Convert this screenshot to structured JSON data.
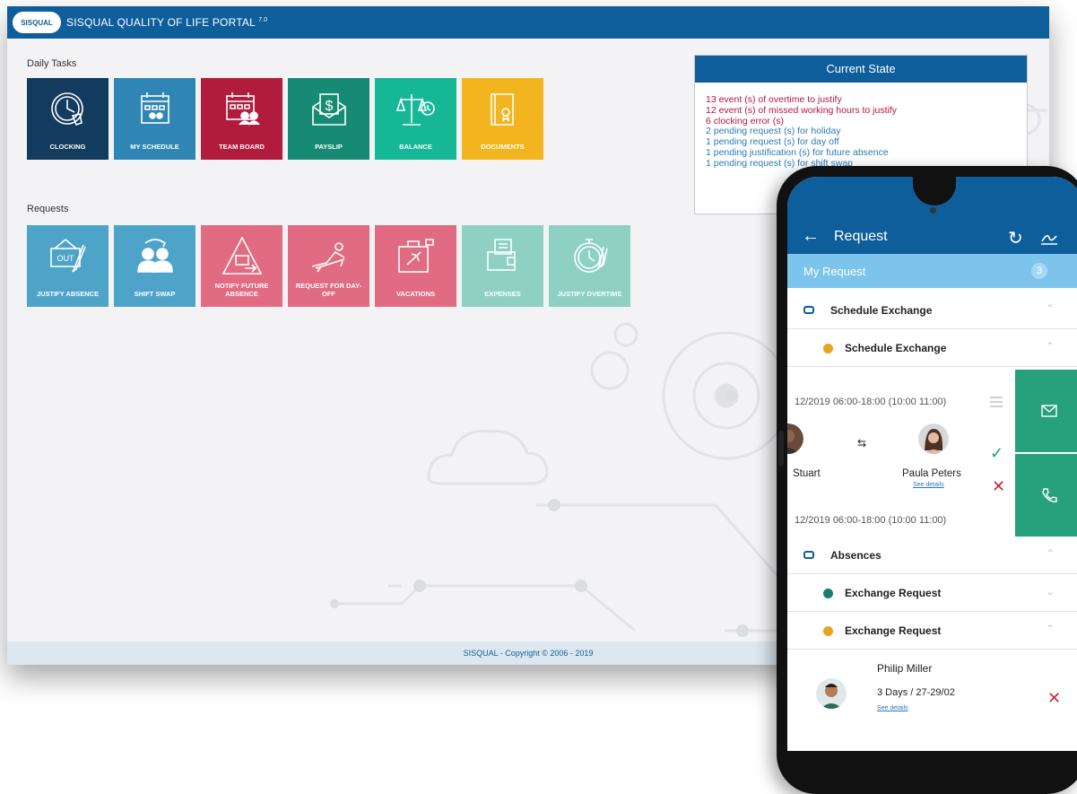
{
  "app": {
    "logo_text": "SISQUAL",
    "title": "SISQUAL QUALITY OF LIFE PORTAL",
    "version": "7.0"
  },
  "daily_tasks": {
    "title": "Daily Tasks",
    "tiles": [
      {
        "label": "CLOCKING",
        "icon": "clock-hand-icon",
        "color": "#123b5e"
      },
      {
        "label": "MY SCHEDULE",
        "icon": "calendar-user-icon",
        "color": "#2f86b4"
      },
      {
        "label": "TEAM BOARD",
        "icon": "calendar-team-icon",
        "color": "#b11c3c"
      },
      {
        "label": "PAYSLIP",
        "icon": "envelope-dollar-icon",
        "color": "#168a72"
      },
      {
        "label": "BALANCE",
        "icon": "scales-icon",
        "color": "#16b796"
      },
      {
        "label": "DOCUMENTS",
        "icon": "document-icon",
        "color": "#f3b51f"
      }
    ]
  },
  "requests": {
    "title": "Requests",
    "tiles": [
      {
        "label": "JUSTIFY ABSENCE",
        "icon": "out-sign-icon",
        "color": "#4ea3c8"
      },
      {
        "label": "SHIFT SWAP",
        "icon": "people-swap-icon",
        "color": "#4ea3c8"
      },
      {
        "label": "NOTIFY FUTURE ABSENCE",
        "icon": "warning-out-icon",
        "color": "#e06b82"
      },
      {
        "label": "REQUEST FOR DAY-OFF",
        "icon": "lounge-icon",
        "color": "#e06b82"
      },
      {
        "label": "VACATIONS",
        "icon": "suitcase-plane-icon",
        "color": "#e06b82"
      },
      {
        "label": "EXPENSES",
        "icon": "wallet-receipt-icon",
        "color": "#8ed1c2"
      },
      {
        "label": "JUSTIFY OVERTIME",
        "icon": "stopwatch-icon",
        "color": "#8ed1c2"
      }
    ]
  },
  "current_state": {
    "title": "Current State",
    "items": [
      {
        "text": "13 event (s) of overtime to justify",
        "tone": "red"
      },
      {
        "text": "12 event (s) of missed working hours to justify",
        "tone": "red"
      },
      {
        "text": "6 clocking error (s)",
        "tone": "red"
      },
      {
        "text": "2 pending request (s) for holiday",
        "tone": "blue"
      },
      {
        "text": "1 pending request (s) for day off",
        "tone": "blue"
      },
      {
        "text": "1 pending justification (s) for future absence",
        "tone": "blue"
      },
      {
        "text": "1 pending request (s) for shift swap",
        "tone": "blue"
      }
    ]
  },
  "footer": {
    "text": "SISQUAL - Copyright © 2006 - 2019"
  },
  "phone": {
    "title": "Request",
    "my_request_label": "My Request",
    "my_request_count": "3",
    "rows": {
      "schedule_group": "Schedule Exchange",
      "schedule_item": "Schedule Exchange",
      "absences_group": "Absences",
      "exchange_1": "Exchange Request",
      "exchange_2": "Exchange Request"
    },
    "card": {
      "date_1": "12/2019 06:00-18:00 (10:00 11:00)",
      "date_2": "12/2019 06:00-18:00 (10:00 11:00)",
      "left_name": "Stuart",
      "right_name": "Paula Peters",
      "see_details": "See details"
    },
    "bottom": {
      "name": "Philip Miller",
      "detail": "3 Days / 27-29/02",
      "see_details": "See details"
    },
    "colors": {
      "dot_yellow": "#e0a624",
      "dot_green": "#18806a"
    }
  }
}
